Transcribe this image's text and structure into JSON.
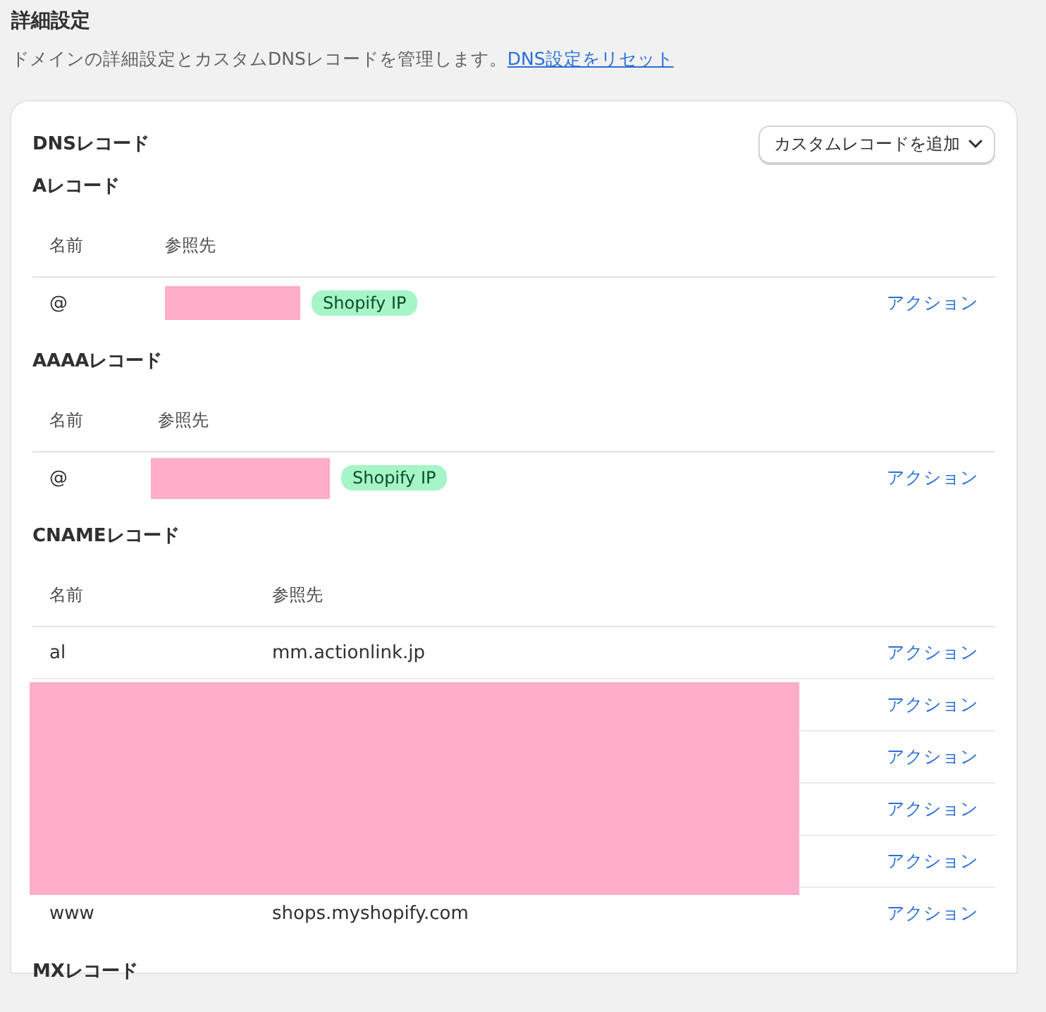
{
  "page": {
    "title": "詳細設定",
    "description": "ドメインの詳細設定とカスタムDNSレコードを管理します。",
    "reset_link": "DNS設定をリセット"
  },
  "card": {
    "title": "DNSレコード",
    "add_button": "カスタムレコードを追加",
    "sections": [
      {
        "title": "Aレコード",
        "columns": [
          "名前",
          "参照先"
        ],
        "rows": [
          {
            "kind": "masked-target",
            "name": "@",
            "badge": "Shopify IP",
            "action": "アクション"
          }
        ]
      },
      {
        "title": "AAAAレコード",
        "columns": [
          "名前",
          "参照先"
        ],
        "rows": [
          {
            "kind": "masked-target",
            "name": "@",
            "badge": "Shopify IP",
            "action": "アクション"
          }
        ]
      },
      {
        "title": "CNAMEレコード",
        "columns": [
          "名前",
          "参照先"
        ],
        "rows": [
          {
            "kind": "record",
            "name": "al",
            "target": "mm.actionlink.jp",
            "action": "アクション"
          },
          {
            "kind": "masked",
            "action": "アクション"
          },
          {
            "kind": "masked",
            "action": "アクション"
          },
          {
            "kind": "masked",
            "action": "アクション"
          },
          {
            "kind": "masked",
            "action": "アクション"
          },
          {
            "kind": "record",
            "name": "www",
            "target": "shops.myshopify.com",
            "action": "アクション"
          }
        ]
      },
      {
        "title": "MXレコード"
      }
    ]
  }
}
